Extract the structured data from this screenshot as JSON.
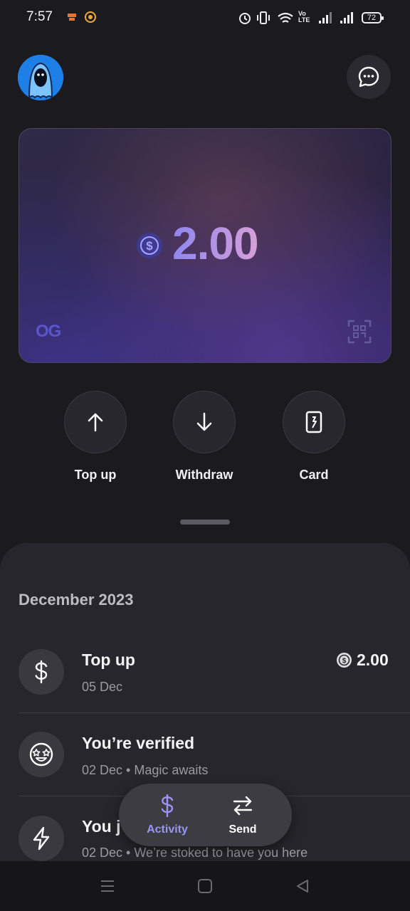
{
  "status_bar": {
    "time": "7:57",
    "battery": "72",
    "network_label": "Vo LTE"
  },
  "header": {
    "avatar_icon": "ghost-avatar",
    "chat_icon": "chat-bubble-icon"
  },
  "balance_card": {
    "amount": "2.00",
    "currency_icon": "usdc-coin-icon",
    "brand": "OG",
    "scan_icon": "qr-scan-icon"
  },
  "actions": [
    {
      "label": "Top up",
      "icon": "arrow-up-icon"
    },
    {
      "label": "Withdraw",
      "icon": "arrow-down-icon"
    },
    {
      "label": "Card",
      "icon": "card-icon"
    }
  ],
  "activity": {
    "month": "December 2023",
    "items": [
      {
        "title": "Top up",
        "subtitle": "05 Dec",
        "amount": "2.00",
        "icon": "dollar-icon"
      },
      {
        "title": "You’re verified",
        "subtitle": "02 Dec • Magic awaits",
        "icon": "star-eyes-face-icon"
      },
      {
        "title": "You j",
        "subtitle": "02 Dec • We’re stoked to have you here",
        "icon": "lightning-icon"
      }
    ]
  },
  "tabbar": {
    "tabs": [
      {
        "label": "Activity",
        "icon": "dollar-icon",
        "active": true
      },
      {
        "label": "Send",
        "icon": "swap-arrows-icon",
        "active": false
      }
    ]
  },
  "colors": {
    "background": "#1b1a1f",
    "accent": "#9b95f2",
    "sheet": "#27262c"
  }
}
